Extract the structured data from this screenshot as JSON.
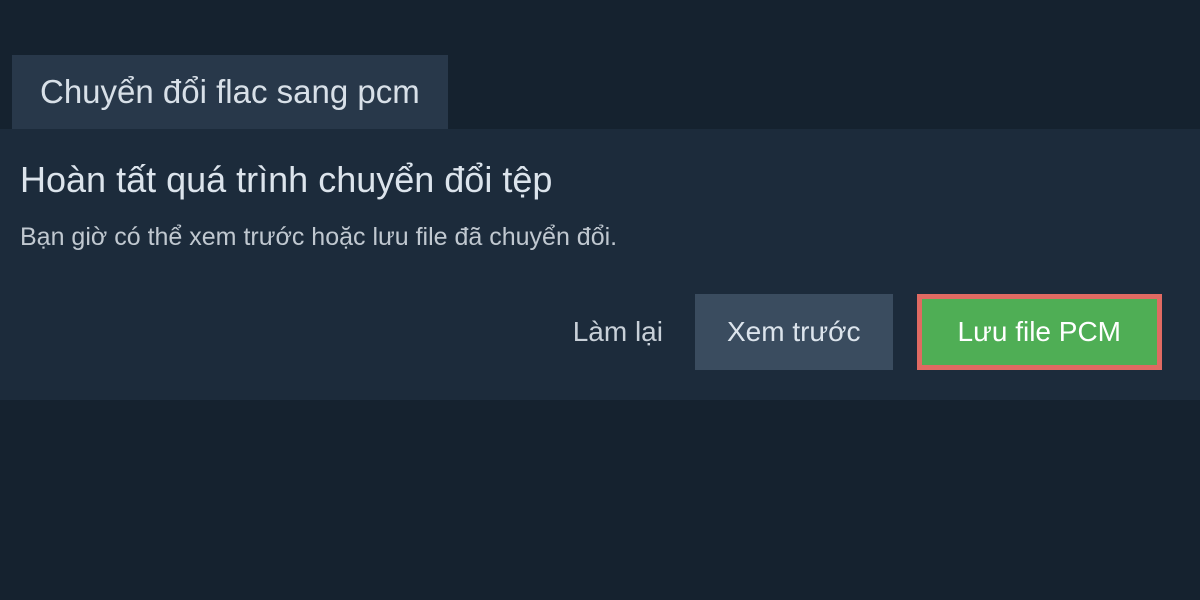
{
  "tab": {
    "title": "Chuyển đổi flac sang pcm"
  },
  "panel": {
    "heading": "Hoàn tất quá trình chuyển đổi tệp",
    "description": "Bạn giờ có thể xem trước hoặc lưu file đã chuyển đổi."
  },
  "buttons": {
    "redo": "Làm lại",
    "preview": "Xem trước",
    "save": "Lưu file PCM"
  }
}
